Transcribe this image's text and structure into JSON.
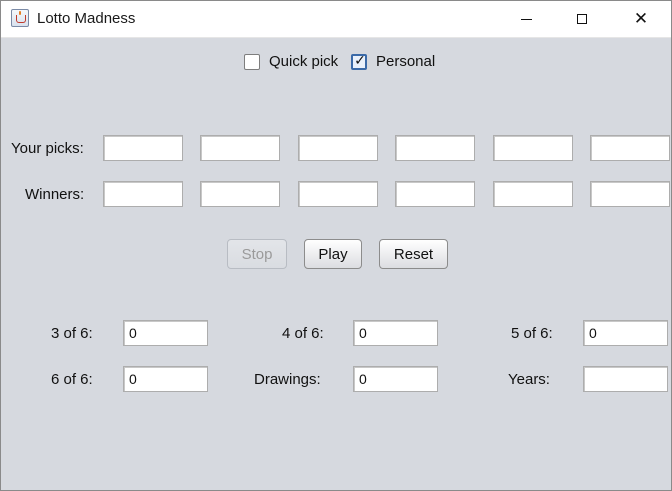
{
  "window": {
    "title": "Lotto Madness"
  },
  "mode": {
    "quick_pick_label": "Quick pick",
    "quick_pick_checked": false,
    "personal_label": "Personal",
    "personal_checked": true
  },
  "picks": {
    "label": "Your picks:",
    "values": [
      "",
      "",
      "",
      "",
      "",
      ""
    ]
  },
  "winners": {
    "label": "Winners:",
    "values": [
      "",
      "",
      "",
      "",
      "",
      ""
    ]
  },
  "controls": {
    "stop_label": "Stop",
    "stop_enabled": false,
    "play_label": "Play",
    "reset_label": "Reset"
  },
  "stats": {
    "three_of_six_label": "3 of 6:",
    "three_of_six_value": "0",
    "four_of_six_label": "4 of 6:",
    "four_of_six_value": "0",
    "five_of_six_label": "5 of 6:",
    "five_of_six_value": "0",
    "six_of_six_label": "6 of 6:",
    "six_of_six_value": "0",
    "drawings_label": "Drawings:",
    "drawings_value": "0",
    "years_label": "Years:",
    "years_value": ""
  }
}
